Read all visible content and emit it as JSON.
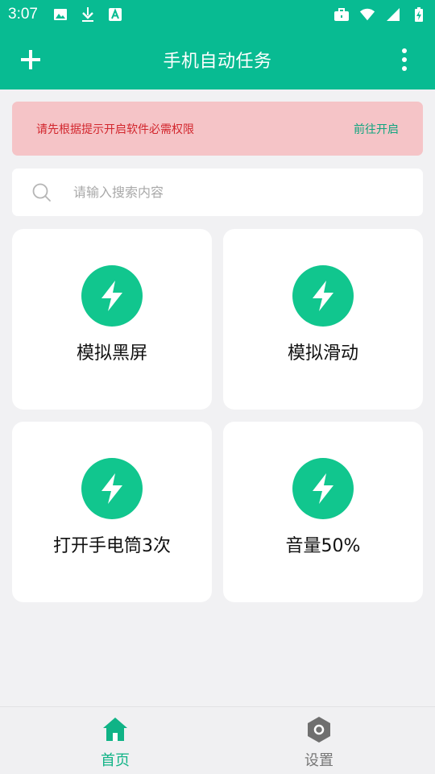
{
  "status_bar": {
    "time": "3:07",
    "left_icons": [
      "image-icon",
      "download-icon",
      "text-a-icon"
    ],
    "right_icons": [
      "briefcase-icon",
      "wifi-icon",
      "signal-icon",
      "battery-charging-icon"
    ]
  },
  "header": {
    "title": "手机自动任务",
    "add_icon": "plus-icon",
    "more_icon": "more-vertical-icon"
  },
  "alert": {
    "text": "请先根据提示开启软件必需权限",
    "link_label": "前往开启"
  },
  "search": {
    "placeholder": "请输入搜索内容",
    "value": ""
  },
  "tasks": [
    {
      "label": "模拟黑屏",
      "icon": "lightning-icon"
    },
    {
      "label": "模拟滑动",
      "icon": "lightning-icon"
    },
    {
      "label": "打开手电筒3次",
      "icon": "lightning-icon"
    },
    {
      "label": "音量50%",
      "icon": "lightning-icon"
    }
  ],
  "tabs": [
    {
      "label": "首页",
      "icon": "home-icon",
      "active": true
    },
    {
      "label": "设置",
      "icon": "settings-icon",
      "active": false
    }
  ],
  "colors": {
    "primary": "#08bb92",
    "accent": "#11c68e",
    "alert_bg": "#f5c4c7",
    "alert_text": "#d2262d",
    "link": "#10a57f"
  }
}
